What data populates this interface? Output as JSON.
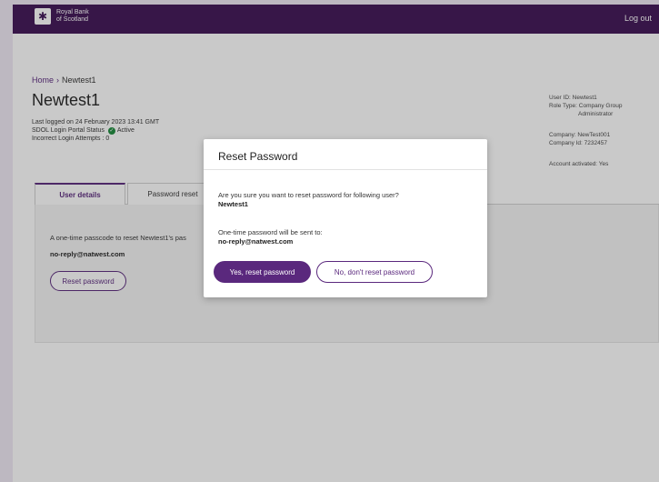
{
  "header": {
    "brand_line1": "Royal Bank",
    "brand_line2": "of Scotland",
    "logout": "Log out"
  },
  "breadcrumb": {
    "home": "Home",
    "separator": "›",
    "current": "Newtest1"
  },
  "user": {
    "title": "Newtest1",
    "last_logged": "Last logged on 24 February 2023 13:41 GMT",
    "status_label": "SDOL Login Portal Status",
    "status_value": "Active",
    "failed_attempts": "Incorrect Login Attempts : 0"
  },
  "side_info": {
    "user_id": "User ID: Newtest1",
    "role_line1": "Role Type: Company Group",
    "role_line2": "Administrator",
    "company": "Company: NewTest001",
    "company_id": "Company Id: 7232457",
    "account": "Account activated: Yes"
  },
  "tabs": [
    {
      "label": "User details",
      "active": true
    },
    {
      "label": "Password reset",
      "active": false
    }
  ],
  "panel": {
    "text": "A one-time passcode to reset Newtest1's pas",
    "email": "no-reply@natwest.com",
    "button": "Reset password"
  },
  "modal": {
    "title": "Reset Password",
    "question": "Are you sure you want to reset password for following user?",
    "username": "Newtest1",
    "sent_to_label": "One-time password will be sent to:",
    "email": "no-reply@natwest.com",
    "confirm": "Yes, reset password",
    "cancel": "No, don't reset password"
  },
  "colors": {
    "brand": "#3c1053",
    "accent": "#5a287d",
    "success": "#1a8a3a"
  }
}
